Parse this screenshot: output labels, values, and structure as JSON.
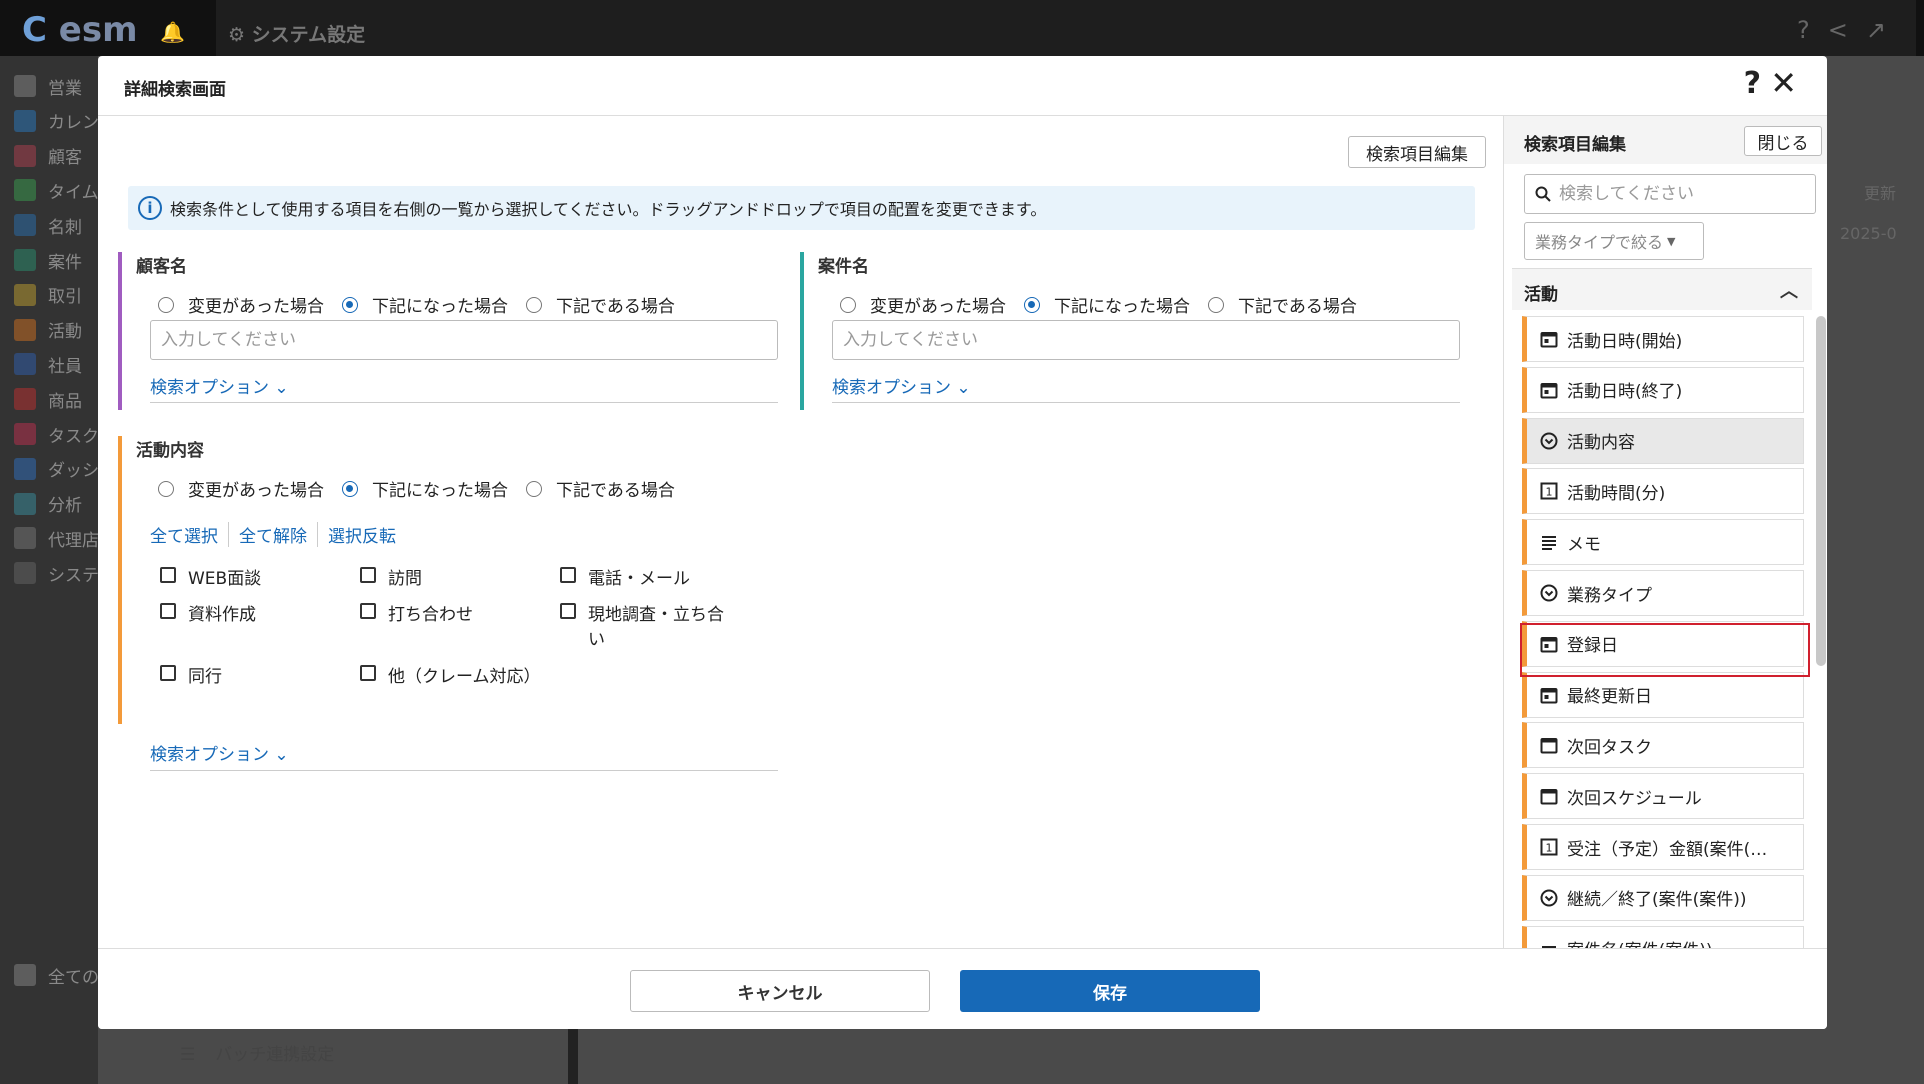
{
  "app": {
    "logo": "esm",
    "top_tab": "システム設定",
    "sidebar": [
      "営業",
      "カレン",
      "顧客",
      "タイム",
      "名刺",
      "案件",
      "取引",
      "活動",
      "社員",
      "商品",
      "タスク",
      "ダッシ",
      "分析",
      "代理店",
      "システ"
    ],
    "sidebar_bottom": "全ての",
    "bg_col_header": "更新",
    "bg_col_value": "2025-0",
    "bg_batch": "バッチ連携設定"
  },
  "modal": {
    "title": "詳細検索画面",
    "edit_fields_button": "検索項目編集",
    "info_text": "検索条件として使用する項目を右側の一覧から選択してください。ドラッグアンドドロップで項目の配置を変更できます。",
    "radio_options": [
      "変更があった場合",
      "下記になった場合",
      "下記である場合"
    ],
    "selected_radio_index": 1,
    "placeholder": "入力してください",
    "search_option": "検索オプション",
    "field_customer": {
      "label": "顧客名",
      "accent": "#a05cc0"
    },
    "field_project": {
      "label": "案件名",
      "accent": "#2aa6a0"
    },
    "field_activity": {
      "label": "活動内容",
      "accent": "#f39a3a",
      "select_all": "全て選択",
      "clear_all": "全て解除",
      "invert": "選択反転",
      "checkboxes": [
        "WEB面談",
        "訪問",
        "電話・メール",
        "資料作成",
        "打ち合わせ",
        "現地調査・立ち合い",
        "同行",
        "他（クレーム対応）"
      ]
    },
    "cancel": "キャンセル",
    "save": "保存"
  },
  "right_panel": {
    "title": "検索項目編集",
    "close": "閉じる",
    "search_placeholder": "検索してください",
    "filter": "業務タイプで絞る",
    "group": "活動",
    "items": [
      {
        "label": "活動日時(開始)",
        "icon": "calendar-icon"
      },
      {
        "label": "活動日時(終了)",
        "icon": "calendar-icon"
      },
      {
        "label": "活動内容",
        "icon": "dropdown-icon",
        "disabled": true
      },
      {
        "label": "活動時間(分)",
        "icon": "number-icon"
      },
      {
        "label": "メモ",
        "icon": "text-lines-icon"
      },
      {
        "label": "業務タイプ",
        "icon": "dropdown-icon",
        "highlighted": true
      },
      {
        "label": "登録日",
        "icon": "calendar-icon"
      },
      {
        "label": "最終更新日",
        "icon": "calendar-icon"
      },
      {
        "label": "次回タスク",
        "icon": "calendar-outline-icon"
      },
      {
        "label": "次回スケジュール",
        "icon": "calendar-outline-icon"
      },
      {
        "label": "受注（予定）金額(案件(…",
        "icon": "number-icon"
      },
      {
        "label": "継続／終了(案件(案件))",
        "icon": "dropdown-icon"
      },
      {
        "label": "案件名(案件(案件))",
        "icon": "text-line-icon"
      }
    ]
  },
  "colors": {
    "primary": "#1769b7",
    "highlight": "#d0202e",
    "item_accent": "#f39a3a"
  }
}
